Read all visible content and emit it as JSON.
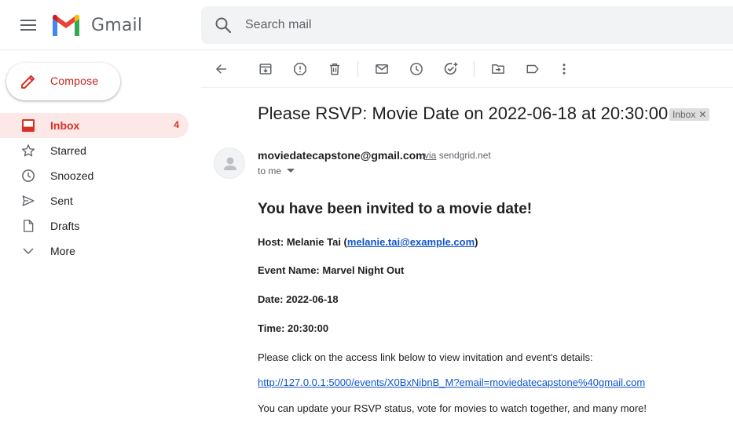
{
  "header": {
    "brand": "Gmail",
    "search_placeholder": "Search mail"
  },
  "compose_label": "Compose",
  "nav": [
    {
      "label": "Inbox",
      "count": "4",
      "icon": "inbox-icon",
      "active": true
    },
    {
      "label": "Starred",
      "count": "",
      "icon": "star-icon",
      "active": false
    },
    {
      "label": "Snoozed",
      "count": "",
      "icon": "clock-icon",
      "active": false
    },
    {
      "label": "Sent",
      "count": "",
      "icon": "send-icon",
      "active": false
    },
    {
      "label": "Drafts",
      "count": "",
      "icon": "draft-icon",
      "active": false
    },
    {
      "label": "More",
      "count": "",
      "icon": "chevron-down-icon",
      "active": false
    }
  ],
  "toolbar_icons": [
    "back-arrow-icon",
    "archive-icon",
    "report-spam-icon",
    "delete-icon",
    "mark-unread-icon",
    "snooze-icon",
    "add-task-icon",
    "move-to-icon",
    "label-icon",
    "more-vert-icon"
  ],
  "message": {
    "subject": "Please RSVP: Movie Date on 2022-06-18 at 20:30:00",
    "label": "Inbox",
    "sender": "moviedatecapstone@gmail.com",
    "via_word": "via",
    "via_domain": "sendgrid.net",
    "to": "to me",
    "heading": "You have been invited to a movie date!",
    "host_prefix": "Host: Melanie Tai (",
    "host_email": "melanie.tai@example.com",
    "host_suffix": ")",
    "event_name": "Event Name: Marvel Night Out",
    "date": "Date: 2022-06-18",
    "time": "Time: 20:30:00",
    "instructions": "Please click on the access link below to view invitation and event's details:",
    "access_link": "http://127.0.0.1:5000/events/X0BxNibnB_M?email=moviedatecapstone%40gmail.com",
    "footer": "You can update your RSVP status, vote for movies to watch together, and many more!"
  },
  "colors": {
    "accent_red": "#d93025",
    "active_bg": "#fce8e6",
    "link": "#1155cc"
  }
}
